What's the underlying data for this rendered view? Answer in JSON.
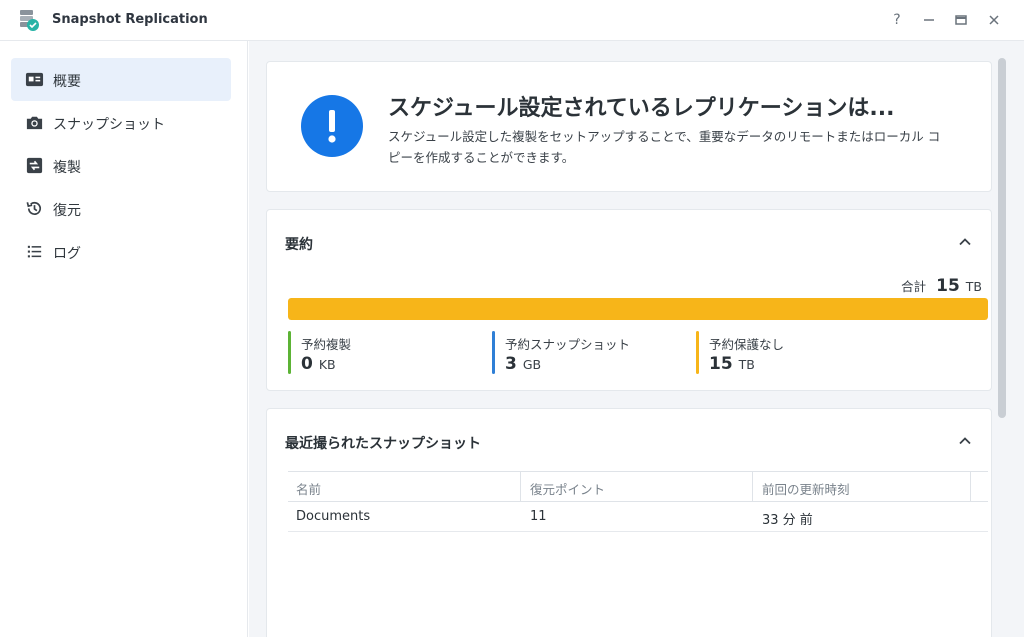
{
  "window": {
    "title": "Snapshot Replication",
    "controls": {
      "help": "?",
      "minimize": "—",
      "maximize": "▭",
      "close": "✕"
    }
  },
  "sidebar": {
    "items": [
      {
        "label": "概要",
        "icon": "overview-icon",
        "active": true
      },
      {
        "label": "スナップショット",
        "icon": "camera-icon",
        "active": false
      },
      {
        "label": "複製",
        "icon": "replication-icon",
        "active": false
      },
      {
        "label": "復元",
        "icon": "restore-icon",
        "active": false
      },
      {
        "label": "ログ",
        "icon": "log-list-icon",
        "active": false
      }
    ]
  },
  "banner": {
    "title": "スケジュール設定されているレプリケーションは...",
    "description": "スケジュール設定した複製をセットアップすることで、重要なデータのリモートまたはローカル コピーを作成することができます。",
    "icon": "exclamation-icon",
    "icon_color": "#1677e6"
  },
  "summary": {
    "title": "要約",
    "total_label": "合計",
    "total_value": "15",
    "total_unit": "TB",
    "usage_fraction": 1.0,
    "items": [
      {
        "label": "予約複製",
        "value": "0",
        "unit": "KB",
        "color": "#5cb335"
      },
      {
        "label": "予約スナップショット",
        "value": "3",
        "unit": "GB",
        "color": "#2f7fd6"
      },
      {
        "label": "予約保護なし",
        "value": "15",
        "unit": "TB",
        "color": "#f7b519"
      }
    ]
  },
  "recent": {
    "title": "最近撮られたスナップショット",
    "columns": [
      "名前",
      "復元ポイント",
      "前回の更新時刻"
    ],
    "rows": [
      [
        "Documents",
        "11",
        "33 分 前"
      ]
    ]
  }
}
